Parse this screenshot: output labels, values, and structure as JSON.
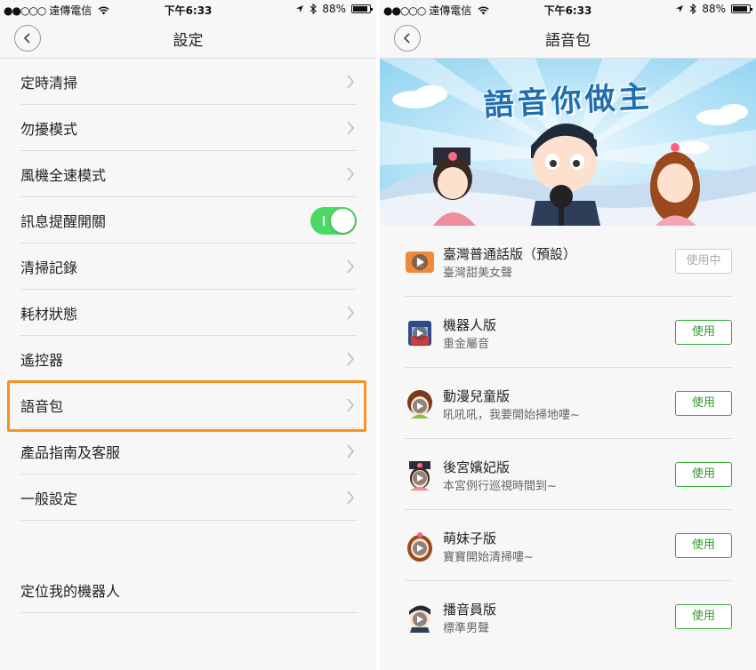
{
  "status": {
    "carrier_dots": "●●○○○",
    "carrier": "遠傳電信",
    "time": "下午6:33",
    "battery": "88%"
  },
  "settings_screen": {
    "title": "設定",
    "items": [
      {
        "label": "定時清掃",
        "type": "chevron"
      },
      {
        "label": "勿擾模式",
        "type": "chevron"
      },
      {
        "label": "風機全速模式",
        "type": "chevron"
      },
      {
        "label": "訊息提醒開關",
        "type": "toggle",
        "toggle_on": true
      },
      {
        "label": "清掃記錄",
        "type": "chevron"
      },
      {
        "label": "耗材狀態",
        "type": "chevron"
      },
      {
        "label": "遙控器",
        "type": "chevron"
      },
      {
        "label": "語音包",
        "type": "chevron",
        "highlighted": true
      },
      {
        "label": "產品指南及客服",
        "type": "chevron"
      },
      {
        "label": "一般設定",
        "type": "chevron"
      }
    ],
    "bottom_item": {
      "label": "定位我的機器人"
    }
  },
  "voice_screen": {
    "title": "語音包",
    "banner_title": "語音你做主",
    "voices": [
      {
        "name": "臺灣普通話版（預設）",
        "desc": "臺灣甜美女聲",
        "button": "使用中",
        "in_use": true,
        "icon": "taiwan-voice-icon"
      },
      {
        "name": "機器人版",
        "desc": "重金屬音",
        "button": "使用",
        "in_use": false,
        "icon": "robot-voice-icon"
      },
      {
        "name": "動漫兒童版",
        "desc": "吼吼吼，我要開始掃地嘍~",
        "button": "使用",
        "in_use": false,
        "icon": "anime-child-voice-icon"
      },
      {
        "name": "後宮嬪妃版",
        "desc": "本宮例行巡視時間到~",
        "button": "使用",
        "in_use": false,
        "icon": "palace-concubine-voice-icon"
      },
      {
        "name": "萌妹子版",
        "desc": "寶寶開始清掃嘍~",
        "button": "使用",
        "in_use": false,
        "icon": "cute-girl-voice-icon"
      },
      {
        "name": "播音員版",
        "desc": "標準男聲",
        "button": "使用",
        "in_use": false,
        "icon": "announcer-voice-icon"
      }
    ]
  },
  "colors": {
    "accent_green": "#4cd964",
    "button_green": "#2e9b2e",
    "highlight_orange": "#f7931e",
    "banner_blue": "#1f6fb0"
  }
}
